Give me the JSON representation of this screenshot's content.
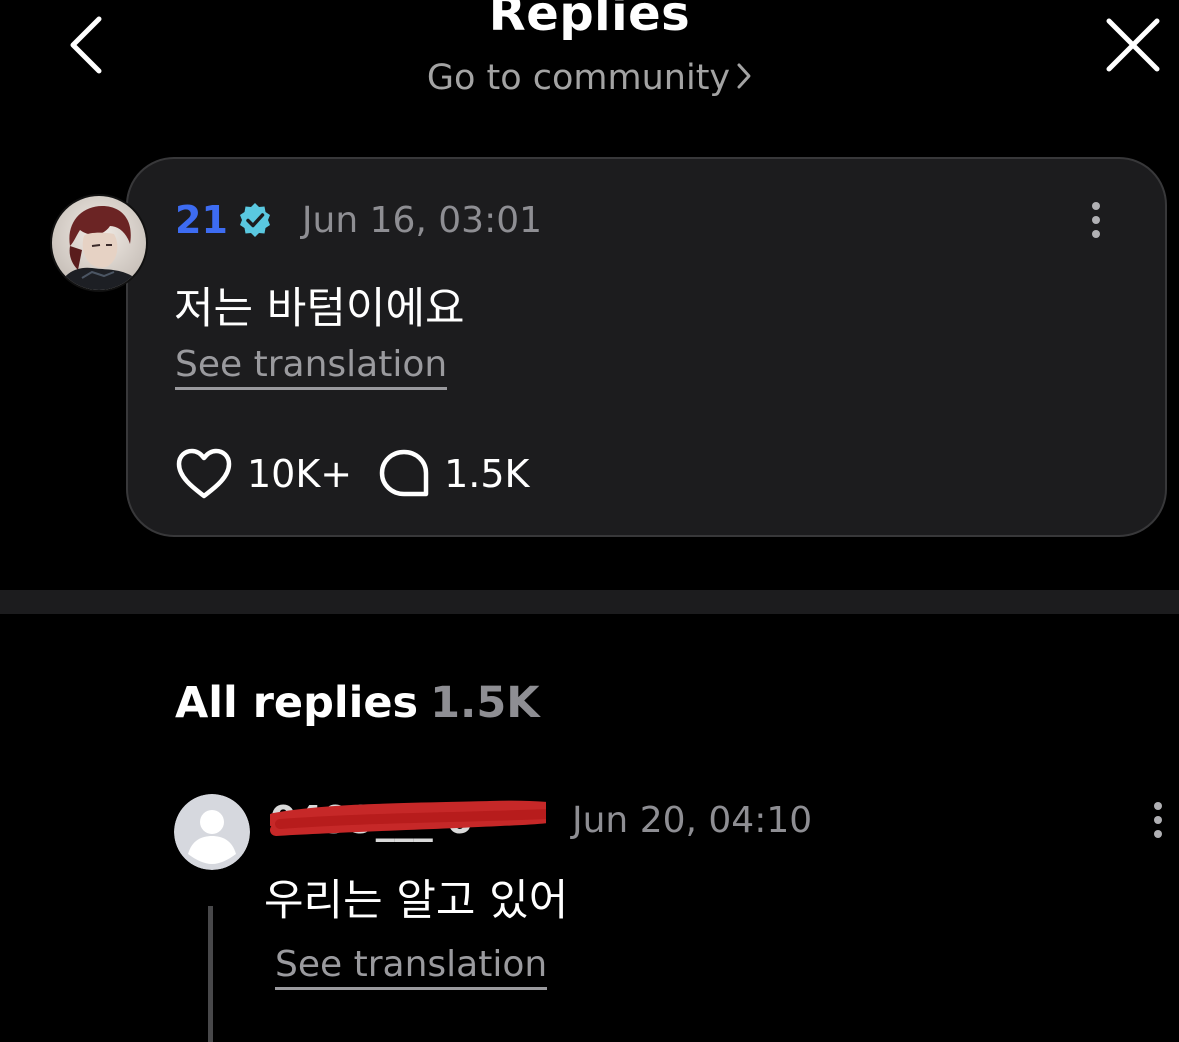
{
  "header": {
    "title": "Replies",
    "community_link": "Go to community",
    "back_icon": "chevron-left-icon",
    "close_icon": "close-icon"
  },
  "post": {
    "author": "21",
    "verified_icon": "verified-badge-icon",
    "date": "Jun 16, 03:01",
    "text": "저는 바텀이에요",
    "translate_label": "See translation",
    "likes": "10K+",
    "comments": "1.5K",
    "like_icon": "heart-icon",
    "comment_icon": "comment-bubble-icon",
    "more_icon": "more-vertical-icon"
  },
  "replies_section": {
    "title": "All replies",
    "count": "1.5K"
  },
  "replies": [
    {
      "author": "0499___ 6",
      "date": "Jun 20, 04:10",
      "text": "우리는 알고 있어",
      "translate_label": "See translation"
    }
  ],
  "colors": {
    "background": "#000000",
    "card": "#1c1c1e",
    "author_blue": "#3d6cf2",
    "verified_cyan": "#5ac8e0",
    "muted_text": "#8e8e93",
    "redaction_red": "#c62828"
  }
}
